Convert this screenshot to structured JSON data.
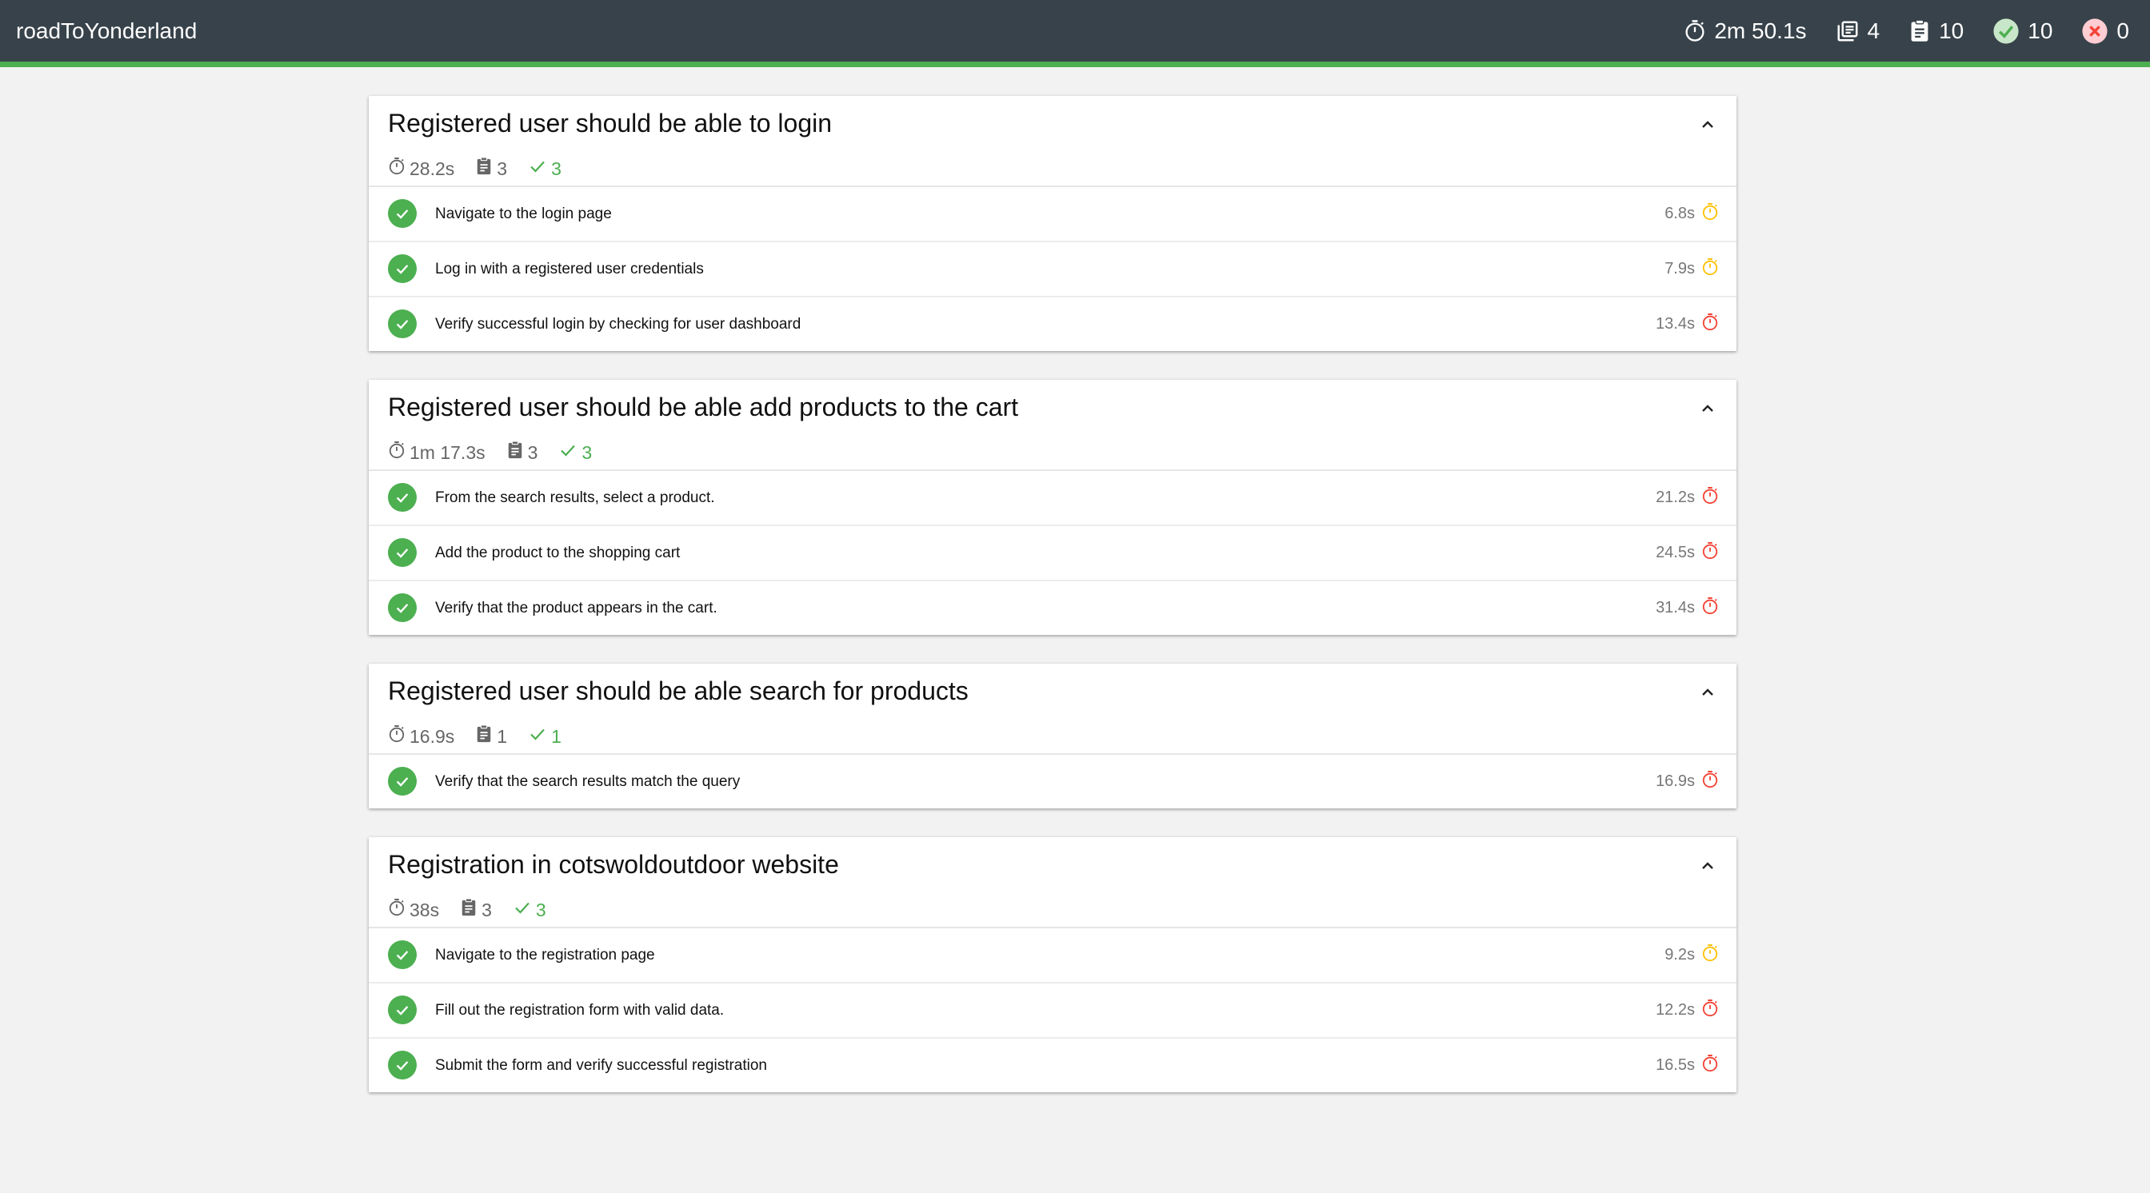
{
  "app": {
    "title": "roadToYonderland"
  },
  "summary": {
    "duration": "2m 50.1s",
    "suites": "4",
    "tests": "10",
    "passed": "10",
    "failed": "0"
  },
  "colors": {
    "header_bg": "#37424a",
    "accent_green": "#4caf50",
    "warning_yellow": "#ffc107",
    "slow_red": "#f44336",
    "fail_red": "#f44336"
  },
  "suites": [
    {
      "title": "Registered user should be able to login",
      "duration": "28.2s",
      "tests_count": "3",
      "passed_count": "3",
      "tests": [
        {
          "title": "Navigate to the login page",
          "duration": "6.8s",
          "speed": "medium"
        },
        {
          "title": "Log in with a registered user credentials",
          "duration": "7.9s",
          "speed": "medium"
        },
        {
          "title": "Verify successful login by checking for user dashboard",
          "duration": "13.4s",
          "speed": "slow"
        }
      ]
    },
    {
      "title": "Registered user should be able add products to the cart",
      "duration": "1m 17.3s",
      "tests_count": "3",
      "passed_count": "3",
      "tests": [
        {
          "title": "From the search results, select a product.",
          "duration": "21.2s",
          "speed": "slow"
        },
        {
          "title": "Add the product to the shopping cart",
          "duration": "24.5s",
          "speed": "slow"
        },
        {
          "title": "Verify that the product appears in the cart.",
          "duration": "31.4s",
          "speed": "slow"
        }
      ]
    },
    {
      "title": "Registered user should be able search for products",
      "duration": "16.9s",
      "tests_count": "1",
      "passed_count": "1",
      "tests": [
        {
          "title": "Verify that the search results match the query",
          "duration": "16.9s",
          "speed": "slow"
        }
      ]
    },
    {
      "title": "Registration in cotswoldoutdoor website",
      "duration": "38s",
      "tests_count": "3",
      "passed_count": "3",
      "tests": [
        {
          "title": "Navigate to the registration page",
          "duration": "9.2s",
          "speed": "medium"
        },
        {
          "title": "Fill out the registration form with valid data.",
          "duration": "12.2s",
          "speed": "slow"
        },
        {
          "title": "Submit the form and verify successful registration",
          "duration": "16.5s",
          "speed": "slow"
        }
      ]
    }
  ]
}
